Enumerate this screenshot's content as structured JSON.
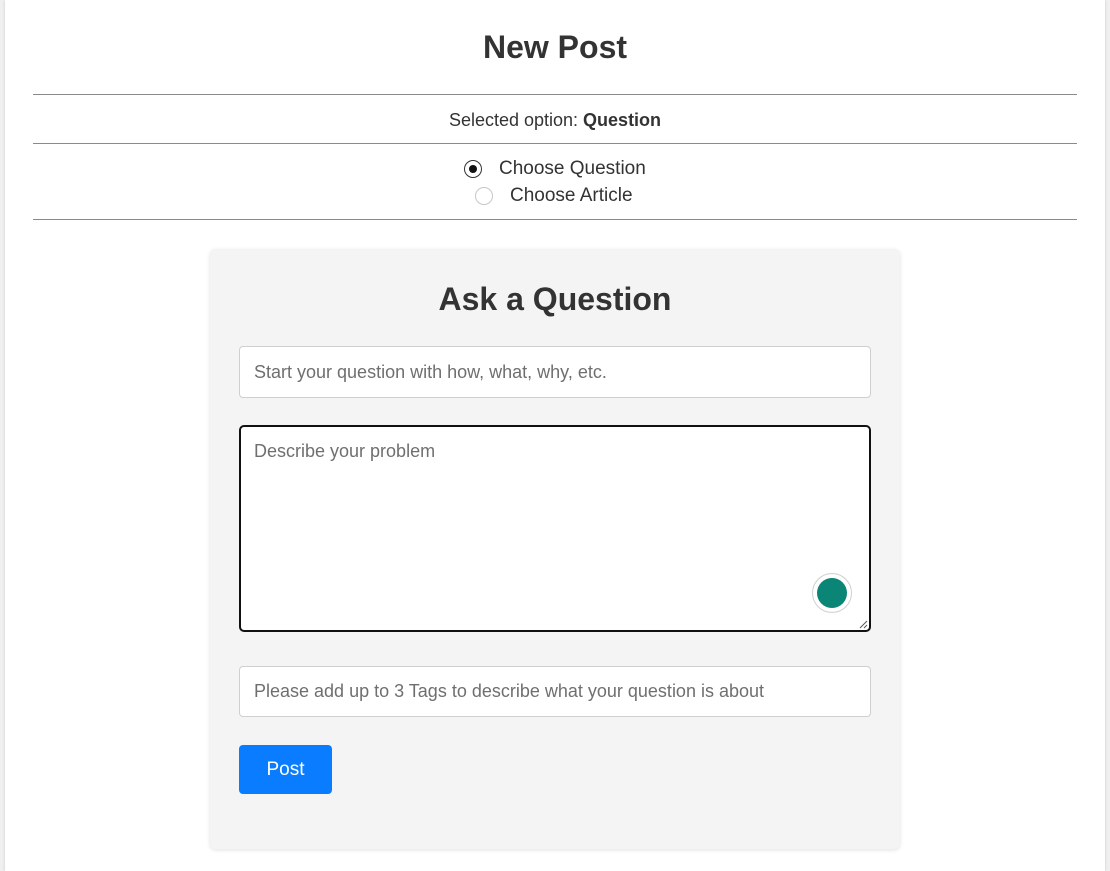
{
  "header": {
    "title": "New Post"
  },
  "selection": {
    "prefix": "Selected option:",
    "value": "Question"
  },
  "options": [
    {
      "label": "Choose Question",
      "checked": true
    },
    {
      "label": "Choose Article",
      "checked": false
    }
  ],
  "form": {
    "title": "Ask a Question",
    "question_placeholder": "Start your question with how, what, why, etc.",
    "description_placeholder": "Describe your problem",
    "tags_placeholder": "Please add up to 3 Tags to describe what your question is about",
    "submit_label": "Post",
    "assist_icon": "assistant-dot-icon"
  },
  "colors": {
    "primary_button": "#0a7cff",
    "assist_dot": "#0b8576",
    "focus_border": "#111111"
  }
}
